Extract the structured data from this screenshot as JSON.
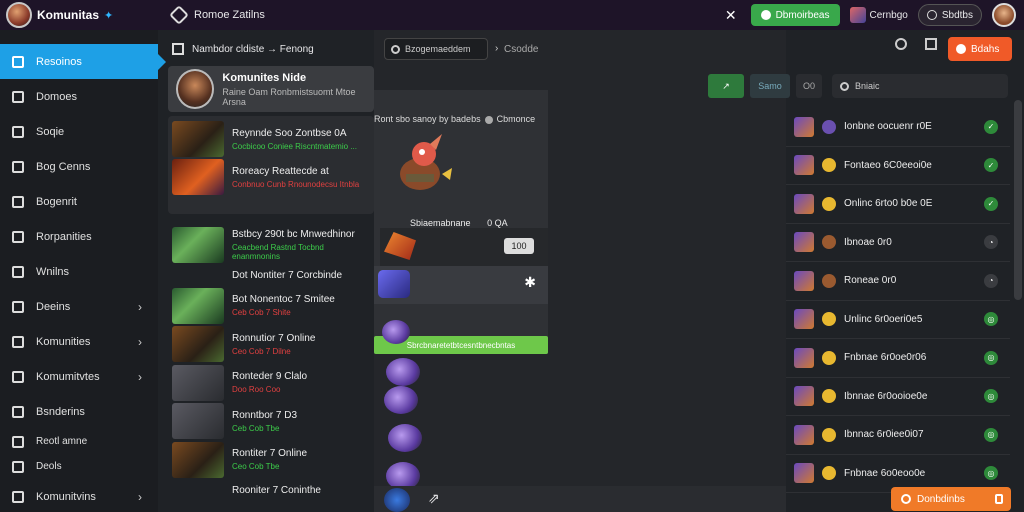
{
  "app": {
    "name": "Komunitas",
    "title": "Romoe Zatilns"
  },
  "topbar": {
    "close_label": "✕",
    "green_button": "Dbmoirbeas",
    "account_label": "Cernbgo",
    "pill_label": "Sbdtbs"
  },
  "sidebar": {
    "items": [
      {
        "label": "Resoinos"
      },
      {
        "label": "Domoes"
      },
      {
        "label": "Soqie"
      },
      {
        "label": "Bog Cenns"
      },
      {
        "label": "Bogenrit"
      },
      {
        "label": "Rorpanities"
      },
      {
        "label": "Wnilns"
      },
      {
        "label": "Deeins"
      },
      {
        "label": "Komunities"
      },
      {
        "label": "Komumitvtes"
      },
      {
        "label": "Bsnderins"
      },
      {
        "label": "Reotl amne"
      },
      {
        "label": "Deols"
      },
      {
        "label": "Komunitvins"
      }
    ]
  },
  "main": {
    "header": "Nambdor cldiste → Fenong",
    "featured": {
      "title": "Komunites Nide",
      "subtitle": "Raine Oam Ronbmistsuomt Mtoe Arsna"
    },
    "suggestions": [
      {
        "title": "Reynnde Soo Zontbse 0A",
        "sub": "Cocbicoo Coniee Riscntmatemio ..."
      },
      {
        "title": "Roreacy Reattecde at",
        "sub": "Conbnuo Cunb Rnounodecsu Itnbla"
      }
    ],
    "rows": [
      {
        "title": "Bstbcy 290t bc Mnwedhinor",
        "sub": "Ceacbend Rastnd Tocbnd enanmnonins"
      },
      {
        "title": "Dot Nontiter 7 Corcbinde",
        "sub": ""
      },
      {
        "title": "Bot Nonentoc 7 Smitee",
        "sub": "Ceb Cob 7 Shite"
      },
      {
        "title": "Ronnutior 7 Online",
        "sub": "Ceo Cob 7 Dilne"
      },
      {
        "title": "Ronteder 9 Clalo",
        "sub": "Doo Roo Coo"
      },
      {
        "title": "Ronntbor 7 D3",
        "sub": "Ceb Cob Tbe"
      },
      {
        "title": "Rontiter 7 Online",
        "sub": "Ceo Cob Tbe"
      },
      {
        "title": "Rooniter 7 Coninthe",
        "sub": ""
      }
    ]
  },
  "center": {
    "search_placeholder": "Bzogemaeddem",
    "tab": "Csodde",
    "popup_header": "Ront sbo sanoy by badebs",
    "popup_header2": "Cbmonce",
    "popup_sub": "Sbiaemabnane",
    "popup_sub2": "0 QA",
    "badge": "100",
    "cta": "Sbrcbnaretetbtcesntbnecbntas"
  },
  "right": {
    "orange_button": "Bdahs",
    "filter_green": "↗",
    "filter_dark": "Samo",
    "filter_small": "O0",
    "search_placeholder": "Bniaic",
    "items": [
      {
        "name": "Ionbne oocuenr r0E",
        "status": "on"
      },
      {
        "name": "Fontaeo 6C0eeoi0e",
        "status": "on"
      },
      {
        "name": "Onlinc 6rto0 b0e 0E",
        "status": "on"
      },
      {
        "name": "Ibnoae 0r0",
        "status": "off"
      },
      {
        "name": "Roneae 0r0",
        "status": "off"
      },
      {
        "name": "Unlinc 6r0oeri0e5",
        "status": "on"
      },
      {
        "name": "Fnbnae 6r0oe0r06",
        "status": "on"
      },
      {
        "name": "Ibnnae 6r0ooioe0e",
        "status": "on"
      },
      {
        "name": "Ibnnac 6r0iee0i07",
        "status": "on"
      },
      {
        "name": "Fnbnae 6o0eoo0e",
        "status": "on"
      }
    ],
    "toast": "Donbdinbs"
  },
  "colors": {
    "accent_blue": "#1ea0e6",
    "green": "#39a84b",
    "orange": "#f05a28"
  }
}
